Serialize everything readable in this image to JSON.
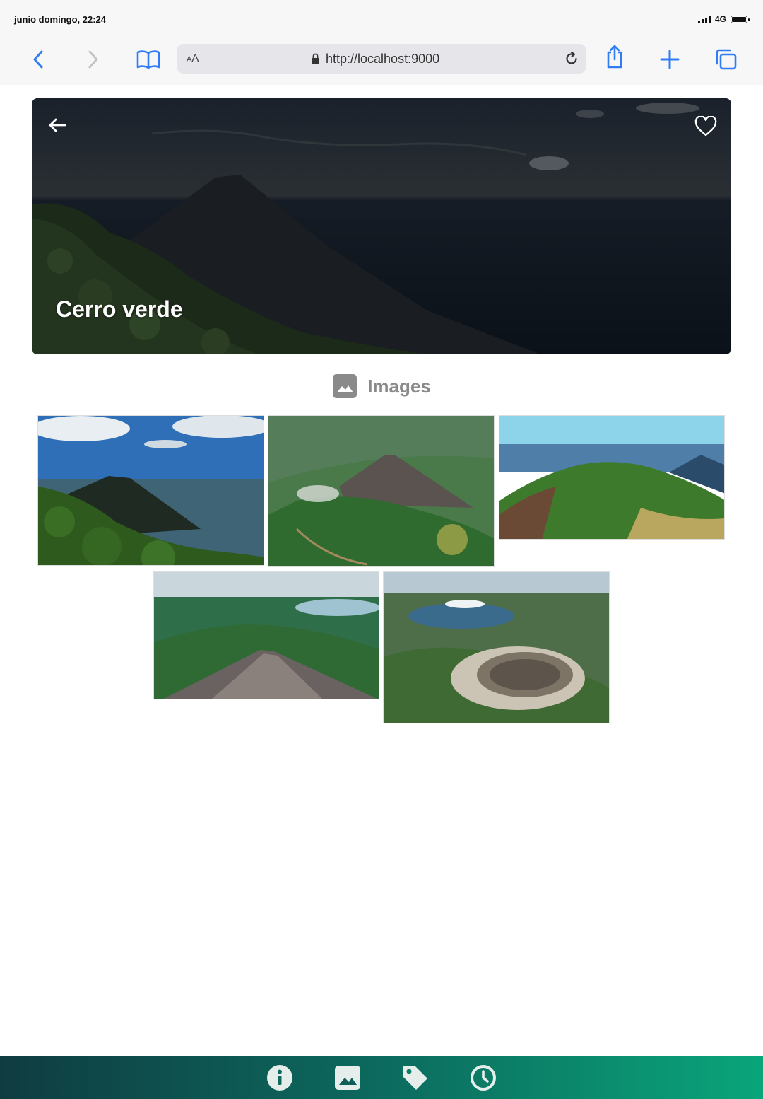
{
  "status_bar": {
    "time": "junio domingo, 22:24",
    "network": "4G"
  },
  "browser": {
    "text_size_label_small": "A",
    "text_size_label_large": "A",
    "url": "http://localhost:9000",
    "icons": [
      "back-icon",
      "forward-icon",
      "bookmarks-icon",
      "lock-icon",
      "reload-icon",
      "share-icon",
      "new-tab-icon",
      "tabs-icon"
    ]
  },
  "hero": {
    "title": "Cerro verde",
    "back_icon": "arrow-left-icon",
    "favorite_icon": "heart-outline-icon"
  },
  "images_section": {
    "title": "Images",
    "icon": "image-icon",
    "photos": [
      {
        "name": "volcano-forest-view"
      },
      {
        "name": "volcano-aerial-view"
      },
      {
        "name": "green-cone-view"
      },
      {
        "name": "volcano-slope-lake-view"
      },
      {
        "name": "crater-lake-view"
      }
    ]
  },
  "bottom_nav": {
    "items": [
      {
        "name": "info",
        "icon": "info-icon"
      },
      {
        "name": "images",
        "icon": "image-icon"
      },
      {
        "name": "tags",
        "icon": "tag-icon"
      },
      {
        "name": "history",
        "icon": "clock-icon"
      }
    ],
    "colors": {
      "start": "#0f3c40",
      "end": "#0aa57a"
    }
  },
  "colors": {
    "accent": "#2f7cf6",
    "section_title": "#8a8a8a"
  }
}
